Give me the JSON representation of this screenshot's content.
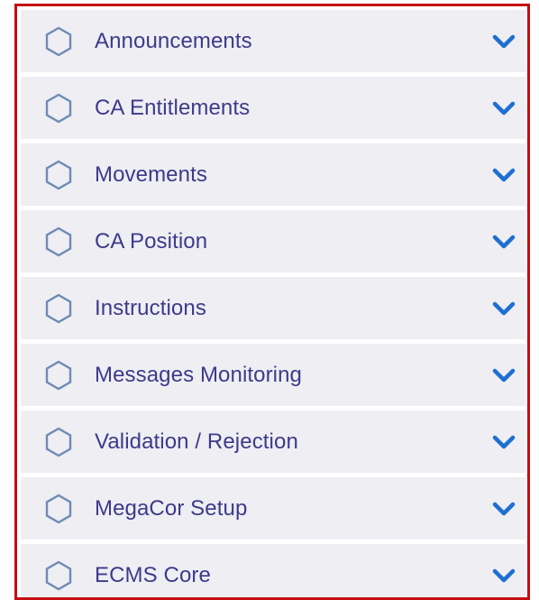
{
  "menu": {
    "items": [
      {
        "label": "Announcements",
        "icon": "hexagon-icon",
        "chevron": "chevron-down-icon"
      },
      {
        "label": "CA Entitlements",
        "icon": "hexagon-icon",
        "chevron": "chevron-down-icon"
      },
      {
        "label": "Movements",
        "icon": "hexagon-icon",
        "chevron": "chevron-down-icon"
      },
      {
        "label": "CA Position",
        "icon": "hexagon-icon",
        "chevron": "chevron-down-icon"
      },
      {
        "label": "Instructions",
        "icon": "hexagon-icon",
        "chevron": "chevron-down-icon"
      },
      {
        "label": "Messages Monitoring",
        "icon": "hexagon-icon",
        "chevron": "chevron-down-icon"
      },
      {
        "label": "Validation / Rejection",
        "icon": "hexagon-icon",
        "chevron": "chevron-down-icon"
      },
      {
        "label": "MegaCor Setup",
        "icon": "hexagon-icon",
        "chevron": "chevron-down-icon"
      },
      {
        "label": "ECMS Core",
        "icon": "hexagon-icon",
        "chevron": "chevron-down-icon"
      }
    ]
  },
  "colors": {
    "frame_border": "#c40d12",
    "item_background": "#eeeef3",
    "label_text": "#3e3a8a",
    "chevron": "#1f6fd1",
    "icon_stroke": "#6e8bb5"
  }
}
